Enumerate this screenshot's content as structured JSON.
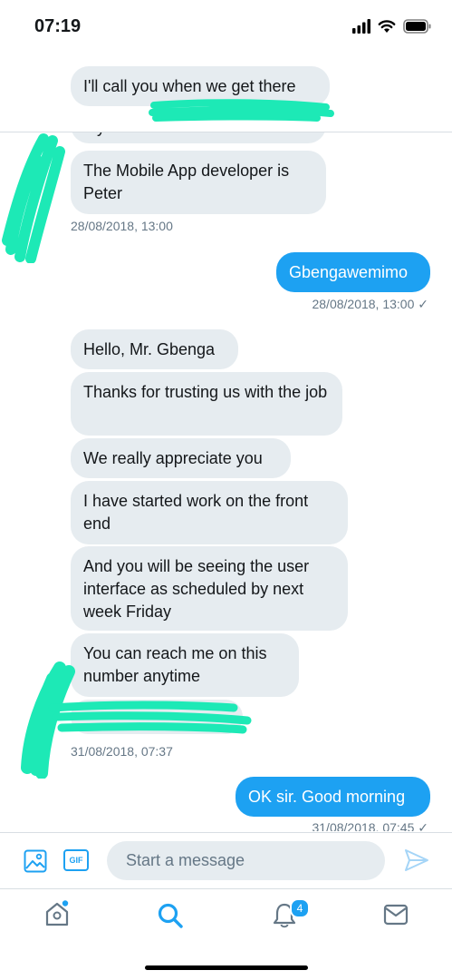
{
  "status_bar": {
    "time": "07:19"
  },
  "messages": {
    "top_bubble": "I'll call you when we get there",
    "cut_off_line": "My name is Victor Awotidebe",
    "developer_msg": "The Mobile App developer is Peter",
    "developer_meta": "28/08/2018, 13:00",
    "out_name": "Gbengawemimo",
    "out_name_meta": "28/08/2018, 13:00 ✓",
    "hello": "Hello, Mr. Gbenga",
    "thanks": "Thanks for trusting us with the job",
    "appreciate": "We really appreciate you",
    "started": "I have started work on the front end",
    "interface": "And you will be seeing the user interface as scheduled by next week Friday",
    "reach": "You can reach me on this number anytime",
    "reach_meta": "31/08/2018, 07:37",
    "ok": "OK sir. Good morning",
    "ok_meta": "31/08/2018, 07:45 ✓"
  },
  "composer": {
    "gif_label": "GIF",
    "placeholder": "Start a message"
  },
  "nav": {
    "notification_count": "4"
  },
  "colors": {
    "accent": "#1da1f2",
    "bubble_in": "#e6ecf0",
    "scribble": "#1de9b6"
  }
}
